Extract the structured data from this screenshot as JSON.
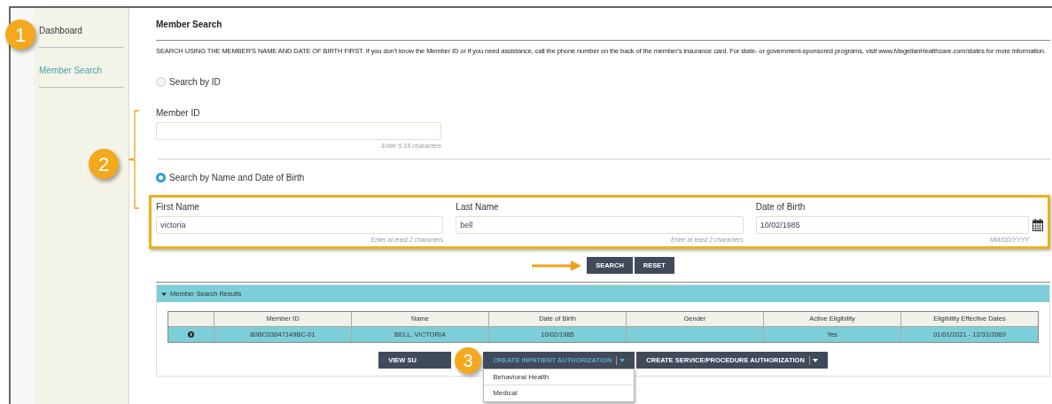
{
  "sidebar": {
    "items": [
      {
        "label": "Dashboard",
        "selected": false
      },
      {
        "label": "Member Search",
        "selected": true
      }
    ]
  },
  "page_title": "Member Search",
  "instructions": "SEARCH USING THE MEMBER'S NAME AND DATE OF BIRTH FIRST. If you don't know the Member ID or if you need assistance, call the phone number on the back of the member's insurance card. For state- or government-sponsored programs, visit www.MagellanHealthcare.com/states for more information.",
  "search_modes": [
    {
      "label": "Search by ID",
      "selected": false
    },
    {
      "label": "Search by Name and Date of Birth",
      "selected": true
    }
  ],
  "member_id_field": {
    "label": "Member ID",
    "hint": "Enter 6-18 characters"
  },
  "name_fields": [
    {
      "label": "First Name",
      "value": "victoria",
      "hint": "Enter at least 2 characters"
    },
    {
      "label": "Last Name",
      "value": "bell",
      "hint": "Enter at least 2 characters"
    },
    {
      "label": "Date of Birth",
      "value": "10/02/1985",
      "hint": "MM/DD/YYYY"
    }
  ],
  "search_buttons": [
    "SEARCH",
    "RESET"
  ],
  "results": {
    "title": "Member Search Results",
    "expanded": true,
    "columns": [
      "Member ID",
      "Name",
      "Date of Birth",
      "Gender",
      "Active Eligibility",
      "Eligibility Effective Dates"
    ],
    "rows": [
      {
        "selected": true,
        "cells": [
          "80BC03047149BC-01",
          "BELL, VICTORIA",
          "10/02/1985",
          "",
          "Yes",
          "01/01/2021 - 12/31/2069"
        ]
      }
    ]
  },
  "actions": [
    {
      "label": "VIEW SU",
      "kind": "plain",
      "open": false
    },
    {
      "label": "CREATE INPATIENT AUTHORIZATION",
      "kind": "split",
      "open": true
    },
    {
      "label": "CREATE SERVICE/PROCEDURE AUTHORIZATION",
      "kind": "split",
      "open": false
    }
  ],
  "dropdown_items": [
    "Behavioral Health",
    "Medical"
  ],
  "callouts": [
    "1",
    "2",
    "3"
  ]
}
